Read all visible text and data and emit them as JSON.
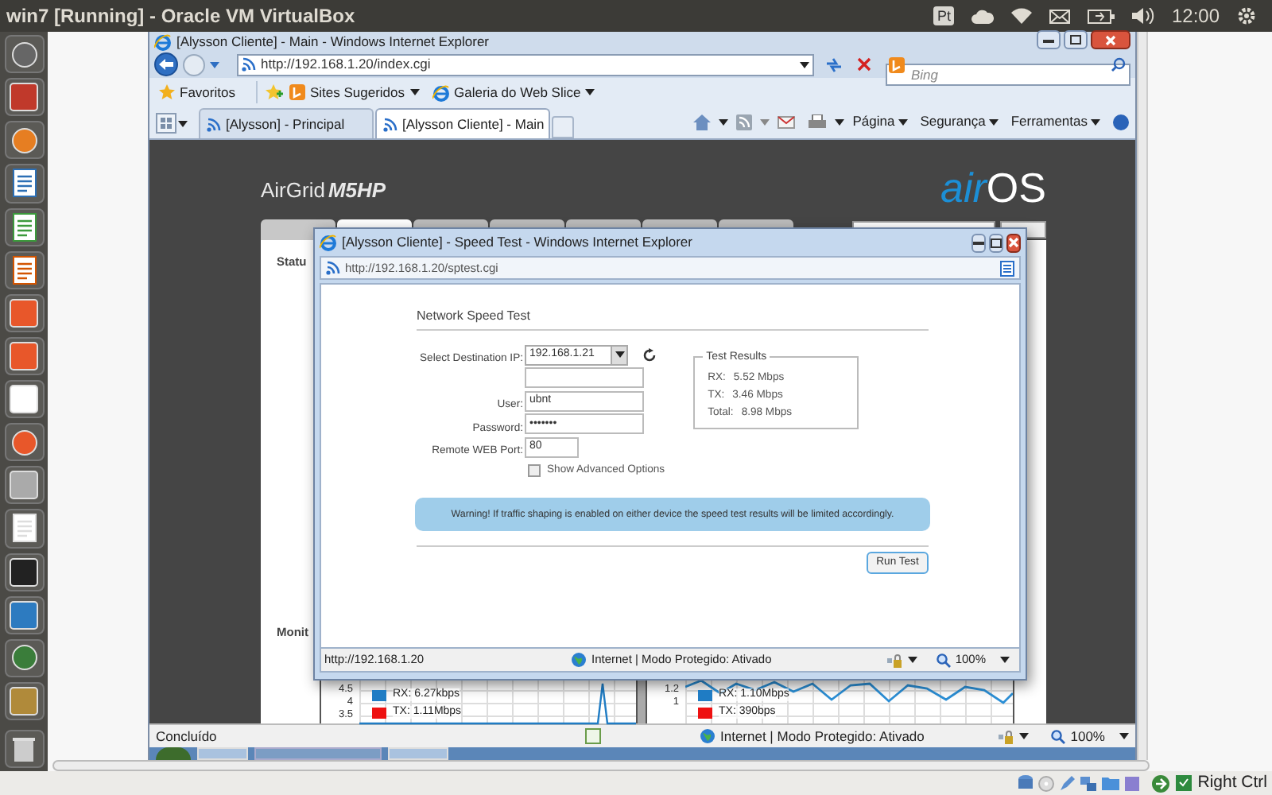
{
  "host_bar": {
    "title": "win7 [Running] - Oracle VM VirtualBox",
    "input_indicator": "Pt",
    "clock": "12:00"
  },
  "browser": {
    "title": "[Alysson Cliente] - Main - Windows Internet Explorer",
    "address": "http://192.168.1.20/index.cgi",
    "search_placeholder": "Bing",
    "favorites": [
      {
        "label": "Favoritos",
        "kind": "star"
      },
      {
        "label": "Sites Sugeridos",
        "kind": "menu"
      },
      {
        "label": "Galeria do Web Slice",
        "kind": "menu"
      }
    ],
    "tabs": [
      {
        "label": "[Alysson] - Principal",
        "selected": false
      },
      {
        "label": "[Alysson Cliente] - Main",
        "selected": true
      }
    ],
    "commands": [
      "Página",
      "Segurança",
      "Ferramentas"
    ],
    "status": {
      "text": "Concluído",
      "zone": "Internet | Modo Protegido: Ativado",
      "zoom": "100%"
    }
  },
  "device_page": {
    "product": "AirGrid",
    "model": "M5HP",
    "brand_prefix": "air",
    "brand_suffix": "OS",
    "sections": [
      "Statu",
      "Monit"
    ],
    "charts": [
      {
        "ticks": [
          "4.5",
          "4",
          "3.5"
        ],
        "legend": [
          {
            "label": "RX: 6.27kbps",
            "color": "#1f7cc4"
          },
          {
            "label": "TX: 1.11Mbps",
            "color": "#ee1111"
          }
        ]
      },
      {
        "ticks": [
          "1.2",
          "1"
        ],
        "legend": [
          {
            "label": "RX: 1.10Mbps",
            "color": "#1f7cc4"
          },
          {
            "label": "TX: 390bps",
            "color": "#ee1111"
          }
        ]
      }
    ]
  },
  "popup": {
    "title": "[Alysson Cliente] - Speed Test - Windows Internet Explorer",
    "address": "http://192.168.1.20/sptest.cgi",
    "heading": "Network Speed Test",
    "fields": [
      {
        "kind": "select",
        "label": "Select Destination IP:",
        "value": "192.168.1.21"
      },
      {
        "kind": "text"
      },
      {
        "kind": "text",
        "label": "User:",
        "value": "ubnt"
      },
      {
        "kind": "text",
        "label": "Password:",
        "value": "•••••••"
      },
      {
        "kind": "short",
        "label": "Remote WEB Port:",
        "value": "80"
      }
    ],
    "option": {
      "label": "Show Advanced Options",
      "checked": false
    },
    "results": {
      "title": "Test Results",
      "rows": [
        {
          "label": "RX:",
          "value": "5.52 Mbps"
        },
        {
          "label": "TX:",
          "value": "3.46 Mbps"
        },
        {
          "label": "Total:",
          "value": "8.98 Mbps"
        }
      ]
    },
    "warning": "Warning! If traffic shaping is enabled on either device the speed test results will be limited accordingly.",
    "button": "Run Test",
    "status": {
      "url": "http://192.168.1.20",
      "zone": "Internet | Modo Protegido: Ativado",
      "zoom": "100%"
    }
  },
  "vm_status": {
    "hotkey": "Right Ctrl"
  }
}
